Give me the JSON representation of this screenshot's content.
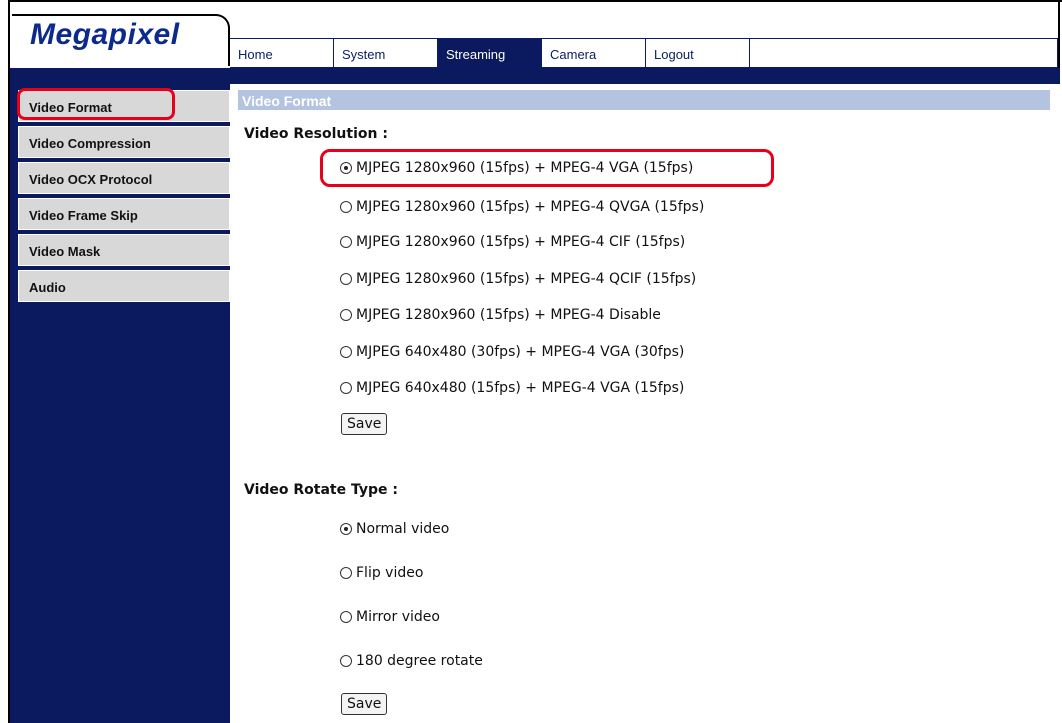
{
  "brand": {
    "logo": "Megapixel"
  },
  "nav": {
    "items": [
      {
        "label": "Home"
      },
      {
        "label": "System"
      },
      {
        "label": "Streaming"
      },
      {
        "label": "Camera"
      },
      {
        "label": "Logout"
      }
    ],
    "active": "Streaming"
  },
  "sidebar": {
    "items": [
      {
        "label": "Video Format"
      },
      {
        "label": "Video Compression"
      },
      {
        "label": "Video OCX Protocol"
      },
      {
        "label": "Video Frame Skip"
      },
      {
        "label": "Video Mask"
      },
      {
        "label": "Audio"
      }
    ],
    "selected": "Video Format"
  },
  "main": {
    "section_title": "Video Format",
    "resolution": {
      "label": "Video Resolution :",
      "options": [
        {
          "label": "MJPEG 1280x960 (15fps) + MPEG-4 VGA (15fps)",
          "checked": true
        },
        {
          "label": "MJPEG 1280x960 (15fps) + MPEG-4 QVGA (15fps)",
          "checked": false
        },
        {
          "label": "MJPEG 1280x960 (15fps) + MPEG-4 CIF (15fps)",
          "checked": false
        },
        {
          "label": "MJPEG 1280x960 (15fps) + MPEG-4 QCIF (15fps)",
          "checked": false
        },
        {
          "label": "MJPEG 1280x960 (15fps) + MPEG-4 Disable",
          "checked": false
        },
        {
          "label": "MJPEG 640x480 (30fps) + MPEG-4 VGA (30fps)",
          "checked": false
        },
        {
          "label": "MJPEG 640x480 (15fps) + MPEG-4 VGA (15fps)",
          "checked": false
        }
      ],
      "save_label": "Save"
    },
    "rotate": {
      "label": "Video Rotate Type :",
      "options": [
        {
          "label": "Normal video",
          "checked": true
        },
        {
          "label": "Flip video",
          "checked": false
        },
        {
          "label": "Mirror video",
          "checked": false
        },
        {
          "label": "180 degree rotate",
          "checked": false
        }
      ],
      "save_label": "Save"
    }
  },
  "colors": {
    "navy": "#0b1a5e",
    "highlight": "#e8001a",
    "section_bar": "#b4c3e0",
    "sidebar_item": "#d8d8d8"
  }
}
